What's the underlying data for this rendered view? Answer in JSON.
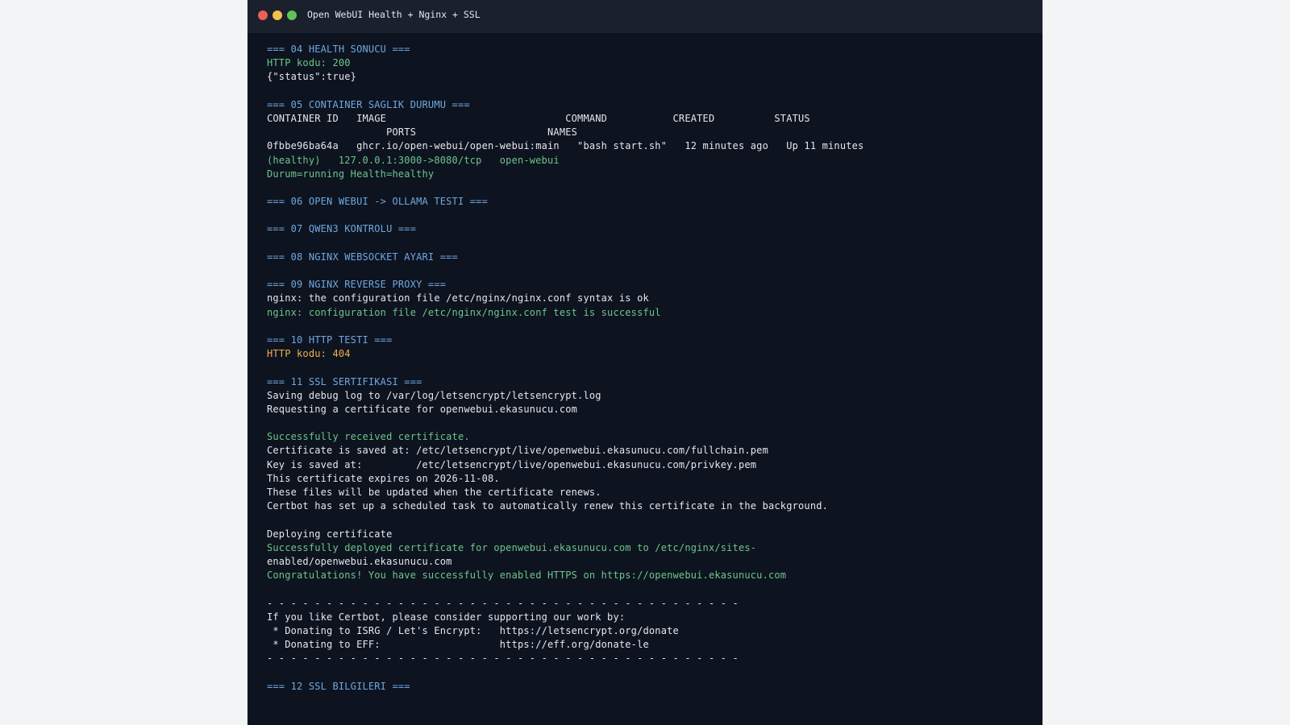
{
  "window": {
    "title": "Open WebUI Health + Nginx + SSL"
  },
  "colors": {
    "header": "#6ea8e0",
    "output": "#e5e7eb",
    "success": "#6cc788",
    "warning": "#f0b04a",
    "background": "#0e1320",
    "titlebar": "#1a202c"
  },
  "terminal": {
    "lines": [
      {
        "text": "=== 04 HEALTH SONUCU ===",
        "kind": "header"
      },
      {
        "text": "HTTP kodu: 200",
        "kind": "success"
      },
      {
        "text": "{\"status\":true}",
        "kind": "output"
      },
      {
        "text": "",
        "kind": "blank"
      },
      {
        "text": "=== 05 CONTAINER SAGLIK DURUMU ===",
        "kind": "header"
      },
      {
        "text": "CONTAINER ID   IMAGE                              COMMAND           CREATED          STATUS",
        "kind": "output"
      },
      {
        "text": "                    PORTS                      NAMES",
        "kind": "output"
      },
      {
        "text": "0fbbe96ba64a   ghcr.io/open-webui/open-webui:main   \"bash start.sh\"   12 minutes ago   Up 11 minutes",
        "kind": "output"
      },
      {
        "text": "(healthy)   127.0.0.1:3000->8080/tcp   open-webui",
        "kind": "success"
      },
      {
        "text": "Durum=running Health=healthy",
        "kind": "success"
      },
      {
        "text": "",
        "kind": "blank"
      },
      {
        "text": "=== 06 OPEN WEBUI -> OLLAMA TESTI ===",
        "kind": "header"
      },
      {
        "text": "",
        "kind": "blank"
      },
      {
        "text": "=== 07 QWEN3 KONTROLU ===",
        "kind": "header"
      },
      {
        "text": "",
        "kind": "blank"
      },
      {
        "text": "=== 08 NGINX WEBSOCKET AYARI ===",
        "kind": "header"
      },
      {
        "text": "",
        "kind": "blank"
      },
      {
        "text": "=== 09 NGINX REVERSE PROXY ===",
        "kind": "header"
      },
      {
        "text": "nginx: the configuration file /etc/nginx/nginx.conf syntax is ok",
        "kind": "output"
      },
      {
        "text": "nginx: configuration file /etc/nginx/nginx.conf test is successful",
        "kind": "success"
      },
      {
        "text": "",
        "kind": "blank"
      },
      {
        "text": "=== 10 HTTP TESTI ===",
        "kind": "header"
      },
      {
        "text": "HTTP kodu: 404",
        "kind": "warning"
      },
      {
        "text": "",
        "kind": "blank"
      },
      {
        "text": "=== 11 SSL SERTIFIKASI ===",
        "kind": "header"
      },
      {
        "text": "Saving debug log to /var/log/letsencrypt/letsencrypt.log",
        "kind": "output"
      },
      {
        "text": "Requesting a certificate for openwebui.ekasunucu.com",
        "kind": "output"
      },
      {
        "text": "",
        "kind": "blank"
      },
      {
        "text": "Successfully received certificate.",
        "kind": "success"
      },
      {
        "text": "Certificate is saved at: /etc/letsencrypt/live/openwebui.ekasunucu.com/fullchain.pem",
        "kind": "output"
      },
      {
        "text": "Key is saved at:         /etc/letsencrypt/live/openwebui.ekasunucu.com/privkey.pem",
        "kind": "output"
      },
      {
        "text": "This certificate expires on 2026-11-08.",
        "kind": "output"
      },
      {
        "text": "These files will be updated when the certificate renews.",
        "kind": "output"
      },
      {
        "text": "Certbot has set up a scheduled task to automatically renew this certificate in the background.",
        "kind": "output"
      },
      {
        "text": "",
        "kind": "blank"
      },
      {
        "text": "Deploying certificate",
        "kind": "output"
      },
      {
        "text": "Successfully deployed certificate for openwebui.ekasunucu.com to /etc/nginx/sites-",
        "kind": "success"
      },
      {
        "text": "enabled/openwebui.ekasunucu.com",
        "kind": "output"
      },
      {
        "text": "Congratulations! You have successfully enabled HTTPS on https://openwebui.ekasunucu.com",
        "kind": "success"
      },
      {
        "text": "",
        "kind": "blank"
      },
      {
        "text": "- - - - - - - - - - - - - - - - - - - - - - - - - - - - - - - - - - - - - - - -",
        "kind": "output"
      },
      {
        "text": "If you like Certbot, please consider supporting our work by:",
        "kind": "output"
      },
      {
        "text": " * Donating to ISRG / Let's Encrypt:   https://letsencrypt.org/donate",
        "kind": "output"
      },
      {
        "text": " * Donating to EFF:                    https://eff.org/donate-le",
        "kind": "output"
      },
      {
        "text": "- - - - - - - - - - - - - - - - - - - - - - - - - - - - - - - - - - - - - - - -",
        "kind": "output"
      },
      {
        "text": "",
        "kind": "blank"
      },
      {
        "text": "=== 12 SSL BILGILERI ===",
        "kind": "header"
      }
    ]
  }
}
